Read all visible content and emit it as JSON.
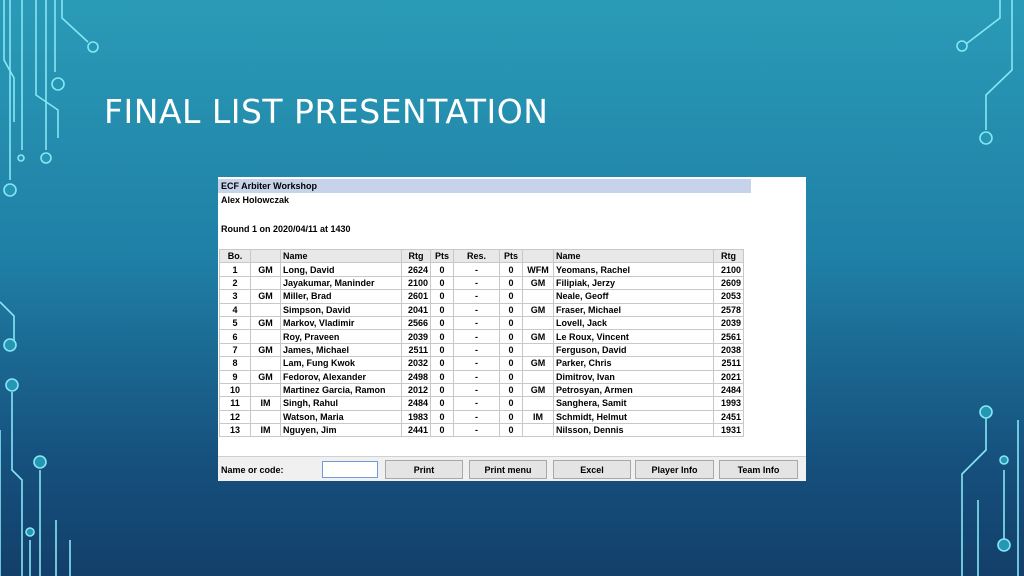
{
  "slide": {
    "title": "FINAL LIST PRESENTATION"
  },
  "header": {
    "bar": "ECF Arbiter Workshop",
    "name": "Alex Holowczak",
    "round": "Round 1 on 2020/04/11 at 1430"
  },
  "table": {
    "columns": [
      "Bo.",
      "",
      "Name",
      "Rtg",
      "Pts",
      "Res.",
      "Pts",
      "",
      "Name",
      "Rtg"
    ],
    "rows": [
      [
        "1",
        "GM",
        "Long, David",
        "2624",
        "0",
        "-",
        "0",
        "WFM",
        "Yeomans, Rachel",
        "2100"
      ],
      [
        "2",
        "",
        "Jayakumar, Maninder",
        "2100",
        "0",
        "-",
        "0",
        "GM",
        "Filipiak, Jerzy",
        "2609"
      ],
      [
        "3",
        "GM",
        "Miller, Brad",
        "2601",
        "0",
        "-",
        "0",
        "",
        "Neale, Geoff",
        "2053"
      ],
      [
        "4",
        "",
        "Simpson, David",
        "2041",
        "0",
        "-",
        "0",
        "GM",
        "Fraser, Michael",
        "2578"
      ],
      [
        "5",
        "GM",
        "Markov, Vladimir",
        "2566",
        "0",
        "-",
        "0",
        "",
        "Lovell, Jack",
        "2039"
      ],
      [
        "6",
        "",
        "Roy, Praveen",
        "2039",
        "0",
        "-",
        "0",
        "GM",
        "Le Roux, Vincent",
        "2561"
      ],
      [
        "7",
        "GM",
        "James, Michael",
        "2511",
        "0",
        "-",
        "0",
        "",
        "Ferguson, David",
        "2038"
      ],
      [
        "8",
        "",
        "Lam, Fung Kwok",
        "2032",
        "0",
        "-",
        "0",
        "GM",
        "Parker, Chris",
        "2511"
      ],
      [
        "9",
        "GM",
        "Fedorov, Alexander",
        "2498",
        "0",
        "-",
        "0",
        "",
        "Dimitrov, Ivan",
        "2021"
      ],
      [
        "10",
        "",
        "Martinez Garcia, Ramon",
        "2012",
        "0",
        "-",
        "0",
        "GM",
        "Petrosyan, Armen",
        "2484"
      ],
      [
        "11",
        "IM",
        "Singh, Rahul",
        "2484",
        "0",
        "-",
        "0",
        "",
        "Sanghera, Samit",
        "1993"
      ],
      [
        "12",
        "",
        "Watson, Maria",
        "1983",
        "0",
        "-",
        "0",
        "IM",
        "Schmidt, Helmut",
        "2451"
      ],
      [
        "13",
        "IM",
        "Nguyen, Jim",
        "2441",
        "0",
        "-",
        "0",
        "",
        "Nilsson, Dennis",
        "1931"
      ]
    ]
  },
  "footer": {
    "label": "Name or code:",
    "input_value": "",
    "buttons": [
      "Print",
      "Print menu",
      "Excel",
      "Player Info",
      "Team Info"
    ]
  },
  "colors": {
    "background_top": "#2a9bb7",
    "background_bottom": "#133f6a",
    "header_bar": "#c7d3ea",
    "circuit_lines": "#7fe3f2"
  },
  "icons": [
    "circuit-decoration-left",
    "circuit-decoration-right"
  ]
}
